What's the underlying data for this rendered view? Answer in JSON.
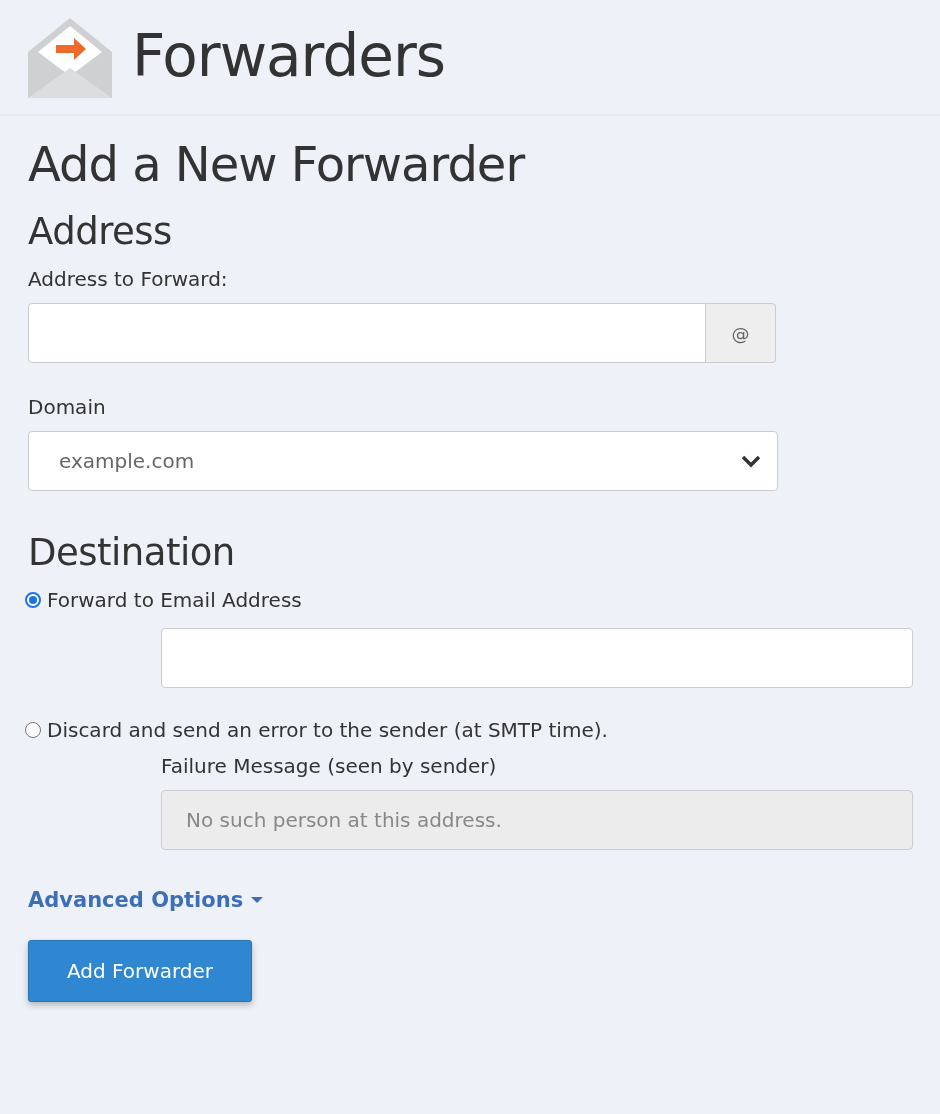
{
  "header": {
    "title": "Forwarders"
  },
  "page_title": "Add a New Forwarder",
  "address_section": {
    "heading": "Address",
    "address_field": {
      "label": "Address to Forward:",
      "addon": "@"
    },
    "domain_field": {
      "label": "Domain",
      "value": "example.com"
    }
  },
  "destination_section": {
    "heading": "Destination",
    "options": [
      {
        "kind": "email",
        "label": "Forward to Email Address",
        "selected": true
      },
      {
        "kind": "failure",
        "label": "Discard and send an error to the sender (at SMTP time).",
        "selected": false,
        "field_label": "Failure Message (seen by sender)",
        "value": "No such person at this address.",
        "disabled": true
      }
    ]
  },
  "advanced_link": "Advanced Options",
  "submit_button": "Add Forwarder"
}
